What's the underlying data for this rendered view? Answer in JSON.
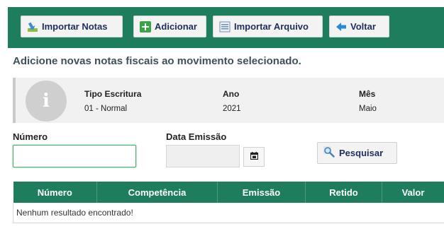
{
  "toolbar": {
    "import_notes": "Importar Notas",
    "add": "Adicionar",
    "import_file": "Importar Arquivo",
    "back": "Voltar"
  },
  "heading": "Adicione novas notas fiscais ao movimento selecionado.",
  "info": {
    "icon_letter": "i",
    "tipo_label": "Tipo Escritura",
    "tipo_value": "01 - Normal",
    "ano_label": "Ano",
    "ano_value": "2021",
    "mes_label": "Mês",
    "mes_value": "Maio"
  },
  "form": {
    "numero_label": "Número",
    "numero_value": "",
    "data_label": "Data Emissão",
    "data_value": "",
    "search_label": "Pesquisar"
  },
  "table": {
    "columns": [
      "Número",
      "Competência",
      "Emissão",
      "Retido",
      "Valor"
    ],
    "empty_message": "Nenhum resultado encontrado!"
  },
  "colors": {
    "brand_green": "#1e7d5c",
    "button_text": "#1d2f5a"
  }
}
